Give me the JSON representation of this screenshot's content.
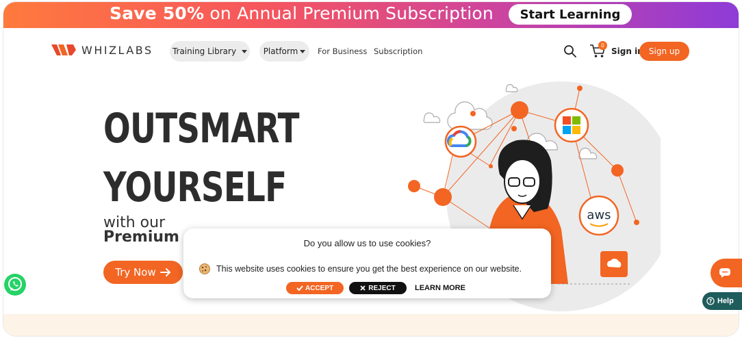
{
  "promo": {
    "highlight": "Save 50%",
    "rest": " on Annual Premium Subscription",
    "cta": "Start Learning"
  },
  "nav": {
    "logo": "WHIZLABS",
    "training_library": "Training Library",
    "platform": "Platform",
    "for_business": "For Business",
    "subscription": "Subscription",
    "cart_count": "0",
    "sign_in": "Sign in",
    "sign_up": "Sign up",
    "icons": [
      "search-icon",
      "cart-icon"
    ]
  },
  "hero": {
    "line1": "OUTSMART",
    "line2": "YOURSELF",
    "sub1": "with our",
    "sub2": "Premium Subscriptio",
    "cta": "Try Now",
    "illustration_labels": {
      "aws": "aws"
    }
  },
  "cookie": {
    "title": "Do you allow us to use cookies?",
    "message": "This website uses cookies to ensure you get the best experience on our website.",
    "accept": "ACCEPT",
    "reject": "REJECT",
    "learn_more": "LEARN MORE"
  },
  "widgets": {
    "help": "Help"
  },
  "colors": {
    "brand_orange": "#f26522",
    "help_teal": "#1f5c5c",
    "band": "#fdf3e6"
  }
}
